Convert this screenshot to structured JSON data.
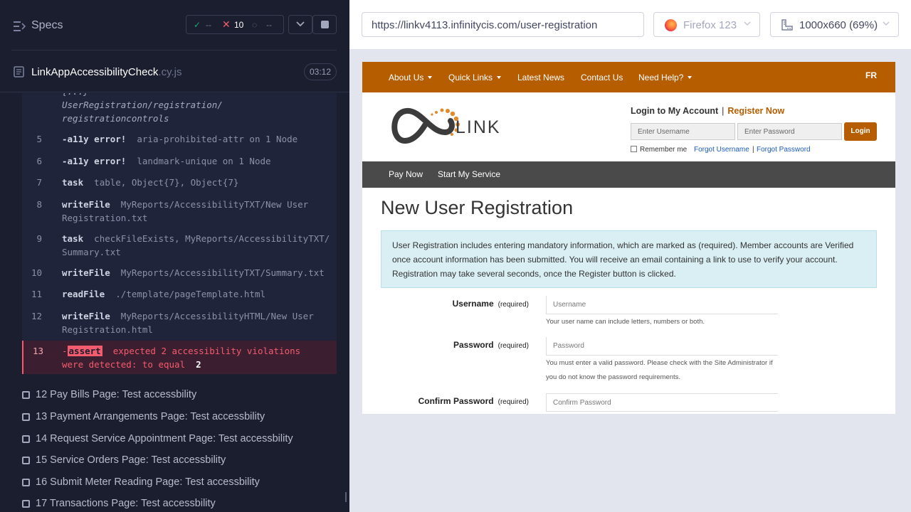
{
  "runner": {
    "specs_title": "Specs",
    "stats": {
      "passed": "--",
      "failed": "10",
      "pending": "--"
    },
    "file": {
      "name": "LinkAppAccessibilityCheck",
      "ext": ".cy.js",
      "duration": "03:12"
    },
    "log": [
      {
        "num": "",
        "lines": [
          "UserRegistration/registration/",
          "registrationcontrols"
        ]
      },
      {
        "num": "5",
        "cmd": "-a11y error!",
        "arg": "aria-prohibited-attr on 1 Node"
      },
      {
        "num": "6",
        "cmd": "-a11y error!",
        "arg": "landmark-unique on 1 Node"
      },
      {
        "num": "7",
        "cmd": "task",
        "arg": "table, Object{7}, Object{7}"
      },
      {
        "num": "8",
        "cmd": "writeFile",
        "arg": "MyReports/AccessibilityTXT/New User",
        "arg2": "Registration.txt"
      },
      {
        "num": "9",
        "cmd": "task",
        "arg": "checkFileExists, MyReports/AccessibilityTXT/",
        "arg2": "Summary.txt"
      },
      {
        "num": "10",
        "cmd": "writeFile",
        "arg": "MyReports/AccessibilityTXT/Summary.txt"
      },
      {
        "num": "11",
        "cmd": "readFile",
        "arg": "./template/pageTemplate.html"
      },
      {
        "num": "12",
        "cmd": "writeFile",
        "arg": "MyReports/AccessibilityHTML/New User",
        "arg2": "Registration.html"
      },
      {
        "num": "13",
        "cmd": "assert",
        "arg": "expected 2 accessibility violations",
        "arg2": "were detected: to equal",
        "eq": "2"
      }
    ],
    "tests": [
      "12 Pay Bills Page: Test accessbility",
      "13 Payment Arrangements Page: Test accessbility",
      "14 Request Service Appointment Page: Test accessbility",
      "15 Service Orders Page: Test accessbility",
      "16 Submit Meter Reading Page: Test accessbility",
      "17 Transactions Page: Test accessbility"
    ]
  },
  "aut": {
    "url": "https://linkv4113.infinitycis.com/user-registration",
    "browser": "Firefox 123",
    "viewport": "1000x660 (69%)"
  },
  "app": {
    "colors": {
      "brand": "#b65d00",
      "subnav": "#4a4a4a",
      "info_bg": "#d9eff4"
    },
    "topnav": [
      "About Us",
      "Quick Links",
      "Latest News",
      "Contact Us",
      "Need Help?"
    ],
    "lang": "FR",
    "logo_text": "LINK",
    "login": {
      "title": "Login to My Account",
      "register": "Register Now",
      "username_ph": "Enter Username",
      "password_ph": "Enter Password",
      "button": "Login",
      "remember": "Remember me",
      "forgot_user": "Forgot Username",
      "forgot_pass": "Forgot Password"
    },
    "subnav": [
      "Pay Now",
      "Start My Service"
    ],
    "page_title": "New User Registration",
    "info": "User Registration includes entering mandatory information, which are marked as (required). Member accounts are Verified once account information has been submitted. You will receive an email containing a link to use to verify your account. Registration may take several seconds, once the Register button is clicked.",
    "fields": [
      {
        "label": "Username",
        "req": "(required)",
        "ph": "Username",
        "help": "Your user name can include letters, numbers or both."
      },
      {
        "label": "Password",
        "req": "(required)",
        "ph": "Password",
        "help": "You must enter a valid password. Please check with the Site Administrator if you do not know the password requirements."
      },
      {
        "label": "Confirm Password",
        "req": "(required)",
        "ph": "Confirm Password"
      }
    ]
  }
}
